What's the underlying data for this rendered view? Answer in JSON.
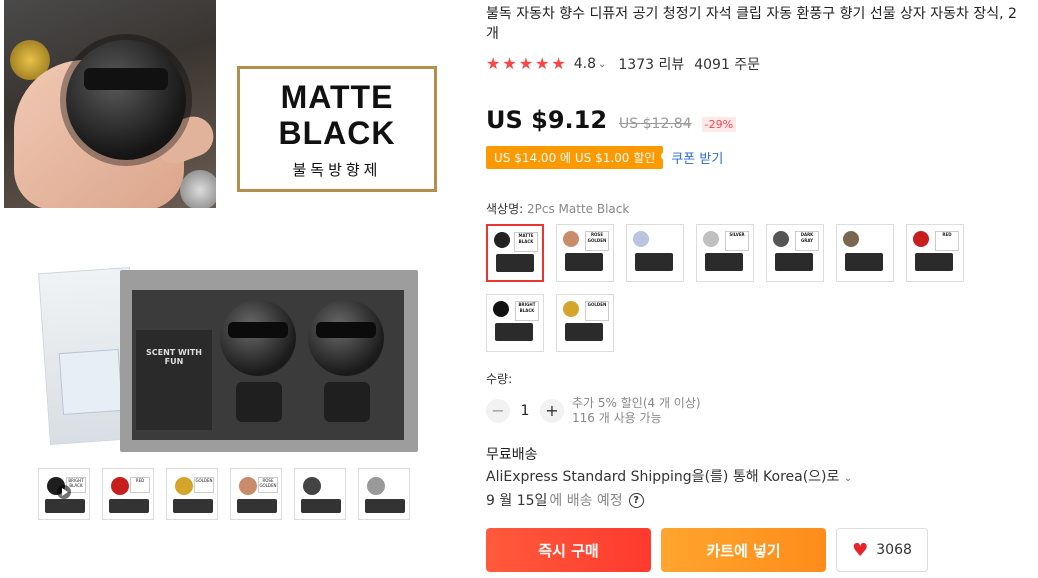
{
  "gallery": {
    "label_line1": "MATTE",
    "label_line2": "BLACK",
    "label_line3": "불독방향제",
    "box_brand": "SCENT WITH FUN",
    "thumbnails": [
      {
        "tag": "BRIGHT BLACK",
        "dog_color": "#1e1e1e"
      },
      {
        "tag": "RED",
        "dog_color": "#c81e1e"
      },
      {
        "tag": "GOLDEN",
        "dog_color": "#d4a52a"
      },
      {
        "tag": "ROSE GOLDEN",
        "dog_color": "#c98b6a"
      },
      {
        "tag": "",
        "dog_color": "#444444"
      },
      {
        "tag": "",
        "dog_color": "#999999"
      }
    ]
  },
  "product": {
    "title": "불독 자동차 향수 디퓨저 공기 청정기 자석 클립 자동 환풍구 향기 선물 상자 자동차 장식, 2 개",
    "rating": "4.8",
    "reviews": "1373 리뷰",
    "orders": "4091 주문",
    "price": "US $9.12",
    "original_price": "US $12.84",
    "discount": "-29%",
    "coupon_text": "US $14.00 에 US $1.00 할인",
    "coupon_link": "쿠폰 받기",
    "color_label": "색상명:",
    "color_value": "2Pcs Matte Black",
    "swatches": [
      {
        "tag": "MATTE BLACK",
        "dog_color": "#222222"
      },
      {
        "tag": "ROSE GOLDEN",
        "dog_color": "#c98b6a"
      },
      {
        "tag": "",
        "dog_color": "#b8c4e0"
      },
      {
        "tag": "SILVER",
        "dog_color": "#c0c0c0"
      },
      {
        "tag": "DARK GRAY",
        "dog_color": "#555555"
      },
      {
        "tag": "",
        "dog_color": "#7a6650"
      },
      {
        "tag": "RED",
        "dog_color": "#c81e1e"
      },
      {
        "tag": "BRIGHT BLACK",
        "dog_color": "#111111"
      },
      {
        "tag": "GOLDEN",
        "dog_color": "#d4a52a"
      }
    ],
    "quantity_label": "수량:",
    "quantity": "1",
    "quantity_note_line1": "추가 5% 할인(4 개 이상)",
    "quantity_note_line2": "116 개 사용 가능",
    "shipping_title": "무료배송",
    "shipping_method": "AliExpress Standard Shipping을(를) 통해 Korea(으)로",
    "delivery_date": "9 월 15일",
    "delivery_suffix": "에 배송 예정",
    "buy_now": "즉시 구매",
    "add_to_cart": "카트에 넣기",
    "wishlist_count": "3068"
  },
  "colors": {
    "accent_red": "#ff4747",
    "coupon_orange": "#ff9900",
    "link_blue": "#2a6ad8",
    "cart_orange": "#ff9a22"
  }
}
